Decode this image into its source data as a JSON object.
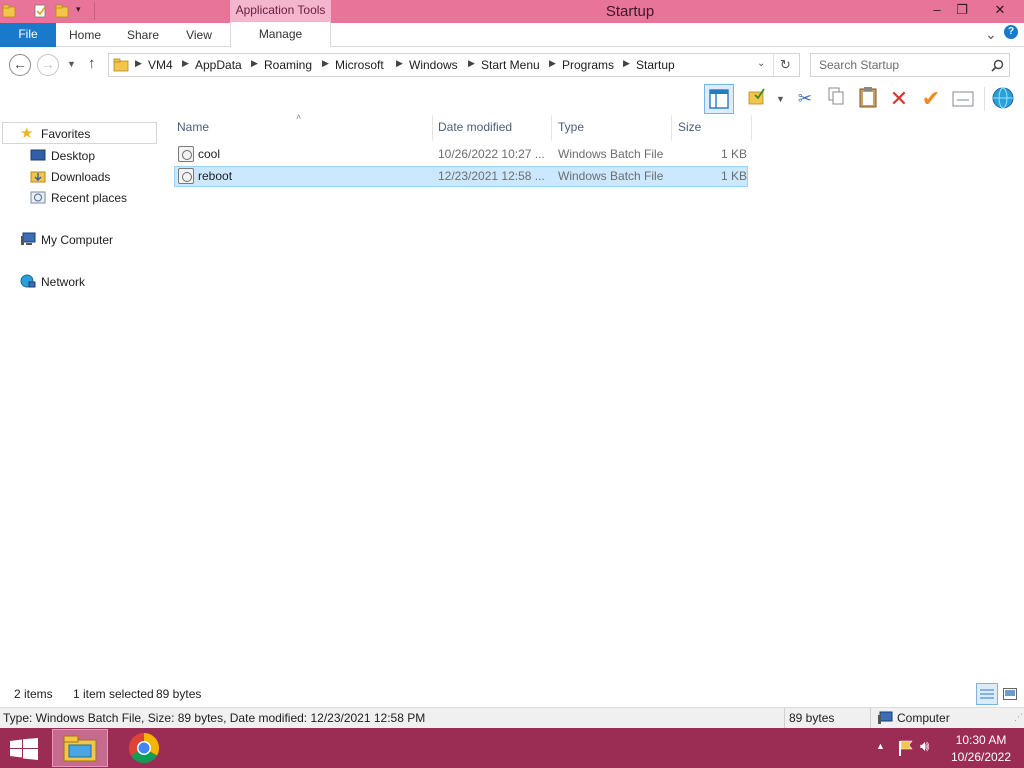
{
  "window": {
    "title": "Startup",
    "contextual_tab_group": "Application Tools",
    "controls": {
      "minimize": "–",
      "restore": "❐",
      "close": "✕"
    }
  },
  "ribbon": {
    "tabs": [
      "File",
      "Home",
      "Share",
      "View",
      "Manage"
    ],
    "collapse_glyph": "⌄",
    "help_glyph": "?"
  },
  "address": {
    "breadcrumbs": [
      "VM4",
      "AppData",
      "Roaming",
      "Microsoft",
      "Windows",
      "Start Menu",
      "Programs",
      "Startup"
    ],
    "search_placeholder": "Search Startup"
  },
  "navigation": {
    "favorites_label": "Favorites",
    "favorites": [
      "Desktop",
      "Downloads",
      "Recent places"
    ],
    "my_computer": "My Computer",
    "network": "Network"
  },
  "file_list": {
    "columns": [
      "Name",
      "Date modified",
      "Type",
      "Size"
    ],
    "rows": [
      {
        "name": "cool",
        "date": "10/26/2022 10:27 ...",
        "type": "Windows Batch File",
        "size": "1 KB",
        "selected": false
      },
      {
        "name": "reboot",
        "date": "12/23/2021 12:58 ...",
        "type": "Windows Batch File",
        "size": "1 KB",
        "selected": true
      }
    ]
  },
  "status": {
    "item_count": "2 items",
    "selection": "1 item selected",
    "selection_size": "89 bytes"
  },
  "details": {
    "text": "Type: Windows Batch File, Size: 89 bytes, Date modified: 12/23/2021 12:58 PM",
    "size": "89 bytes",
    "location": "Computer"
  },
  "taskbar": {
    "time": "10:30 AM",
    "date": "10/26/2022"
  },
  "colors": {
    "titlebar": "#e8749a",
    "file_tab": "#1979ca",
    "selection": "#cce8ff",
    "taskbar": "#9b2d55"
  }
}
